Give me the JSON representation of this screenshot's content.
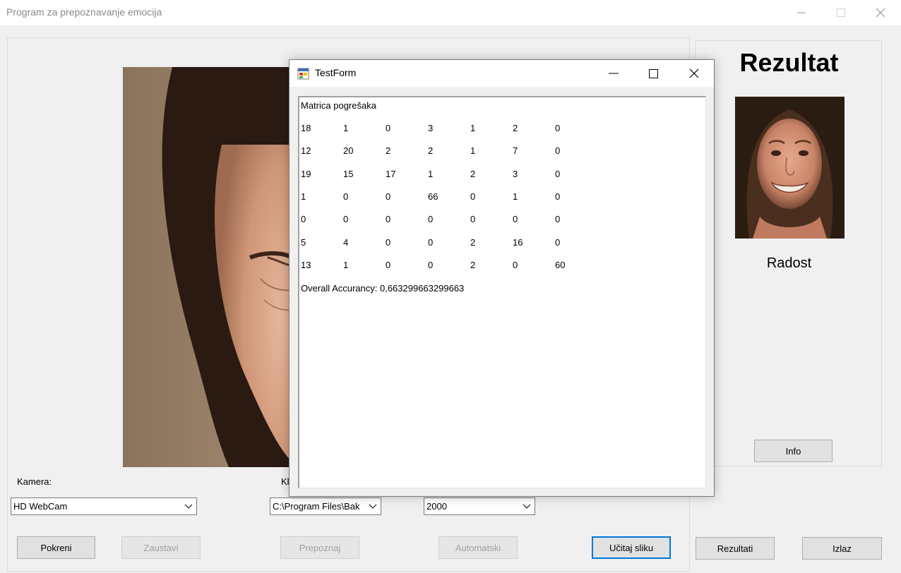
{
  "window": {
    "title": "Program za prepoznavanje emocija"
  },
  "controls": {
    "kamera_label": "Kamera:",
    "klasifikator_label": "Kl",
    "camera_value": "HD WebCam",
    "path_value": "C:\\Program Files\\Bak",
    "interval_value": "2000"
  },
  "buttons": {
    "pokreni": "Pokreni",
    "zaustavi": "Zaustavi",
    "prepoznaj": "Prepoznaj",
    "automatski": "Automatski",
    "ucitaj": "Učitaj sliku",
    "rezultati": "Rezultati",
    "izlaz": "Izlaz",
    "info": "Info"
  },
  "result": {
    "title": "Rezultat",
    "emotion": "Radost"
  },
  "dialog": {
    "title": "TestForm",
    "heading": "Matrica pogrešaka",
    "matrix": [
      [
        "18",
        "1",
        "0",
        "3",
        "1",
        "2",
        "0"
      ],
      [
        "12",
        "20",
        "2",
        "2",
        "1",
        "7",
        "0"
      ],
      [
        "19",
        "15",
        "17",
        "1",
        "2",
        "3",
        "0"
      ],
      [
        "1",
        "0",
        "0",
        "66",
        "0",
        "1",
        "0"
      ],
      [
        "0",
        "0",
        "0",
        "0",
        "0",
        "0",
        "0"
      ],
      [
        "5",
        "4",
        "0",
        "0",
        "2",
        "16",
        "0"
      ],
      [
        "13",
        "1",
        "0",
        "0",
        "2",
        "0",
        "60"
      ]
    ],
    "accuracy": "Overall Accurancy: 0,663299663299663"
  },
  "icons": {
    "minimize": "minimize-icon",
    "maximize": "maximize-icon",
    "close": "close-icon",
    "dropdown": "chevron-down-icon",
    "app": "app-form-icon"
  },
  "colors": {
    "focus_border": "#0078d7",
    "window_bg": "#f0f0f0"
  }
}
